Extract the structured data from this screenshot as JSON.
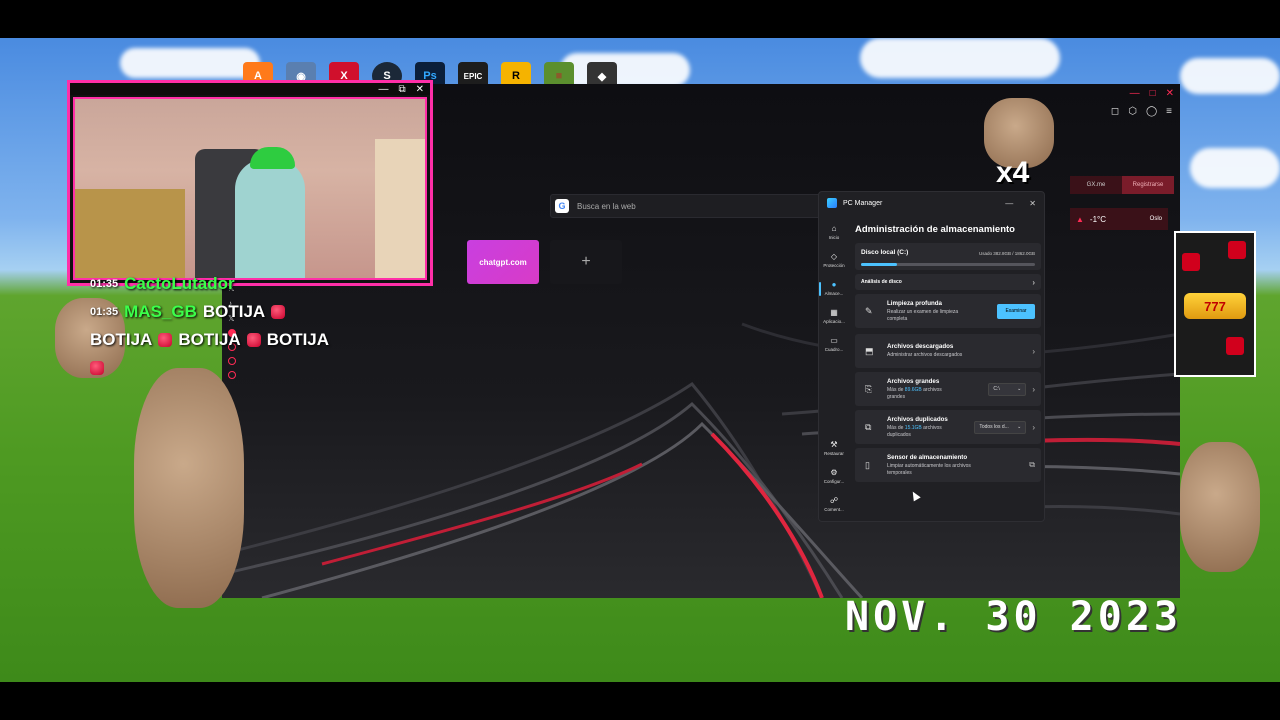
{
  "dock": [
    {
      "name": "avast",
      "glyph": "A",
      "color": "#ff7a1a"
    },
    {
      "name": "app2",
      "glyph": "◉",
      "color": "#5a7fb0"
    },
    {
      "name": "app3",
      "glyph": "X",
      "color": "#d0102c"
    },
    {
      "name": "steam",
      "glyph": "S",
      "color": "#1b2838"
    },
    {
      "name": "photoshop",
      "glyph": "Ps",
      "color": "#0b1f3a"
    },
    {
      "name": "epic-games",
      "glyph": "EPIC",
      "color": "#1d1d1d"
    },
    {
      "name": "rockstar",
      "glyph": "R",
      "color": "#f5b300"
    },
    {
      "name": "minecraft",
      "glyph": "■",
      "color": "#5b8f2e"
    },
    {
      "name": "app9",
      "glyph": "◆",
      "color": "#333"
    }
  ],
  "browser": {
    "search_placeholder": "Busca en la web",
    "search_engine_glyph": "G",
    "speed_dial": [
      {
        "label": "chatgpt.com"
      },
      {
        "label": "+"
      }
    ],
    "gx_buttons": [
      {
        "label": "GX.me"
      },
      {
        "label": "Registrarse"
      }
    ],
    "weather": {
      "temp": "-1°C",
      "city": "Oslo"
    }
  },
  "pc_manager": {
    "title": "PC Manager",
    "heading": "Administración de almacenamiento",
    "nav": [
      {
        "label": "Inicio",
        "icon": "home-icon",
        "glyph": "⌂"
      },
      {
        "label": "Protección",
        "icon": "shield-icon",
        "glyph": "◇"
      },
      {
        "label": "Almace...",
        "icon": "storage-icon",
        "glyph": "●"
      },
      {
        "label": "Aplicacio...",
        "icon": "apps-icon",
        "glyph": "▦"
      },
      {
        "label": "Cuadro...",
        "icon": "toolbox-icon",
        "glyph": "▭"
      },
      {
        "label": "Restaurar",
        "icon": "restore-icon",
        "glyph": "⚒"
      },
      {
        "label": "Configur...",
        "icon": "settings-icon",
        "glyph": "⚙"
      },
      {
        "label": "Coment...",
        "icon": "feedback-icon",
        "glyph": "☍"
      }
    ],
    "disk": {
      "name": "Disco local (C:)",
      "usage": "Usado 382.8GB / 1862.0GB",
      "fraction": 0.2056
    },
    "analysis": "Análisis de disco",
    "deep_clean": {
      "title": "Limpieza profunda",
      "subtitle": "Realizar un examen de limpieza completa",
      "button": "Examinar"
    },
    "downloads": {
      "title": "Archivos descargados",
      "subtitle": "Administrar archivos descargados"
    },
    "large_files": {
      "title": "Archivos grandes",
      "sub_pre": "Más de ",
      "sub_value": "89.6GB",
      "sub_post": " archivos grandes",
      "select": "C:\\"
    },
    "duplicates": {
      "title": "Archivos duplicados",
      "sub_pre": "Más de ",
      "sub_value": "15.1GB",
      "sub_post": " archivos duplicados",
      "select": "Todos los d..."
    },
    "sensor": {
      "title": "Sensor de almacenamiento",
      "subtitle": "Limpiar automáticamente los archivos temporales"
    }
  },
  "chat": [
    {
      "time": "01:35",
      "user": "CactoLutador",
      "message": ""
    },
    {
      "time": "01:35",
      "user": "MAS_GB",
      "message": "BOTIJA"
    }
  ],
  "chat_continuation": [
    "BOTIJA",
    "BOTIJA",
    "BOTIJA"
  ],
  "overlay": {
    "multiplier": "x4",
    "date": "NOV. 30 2023",
    "slot": "777"
  }
}
